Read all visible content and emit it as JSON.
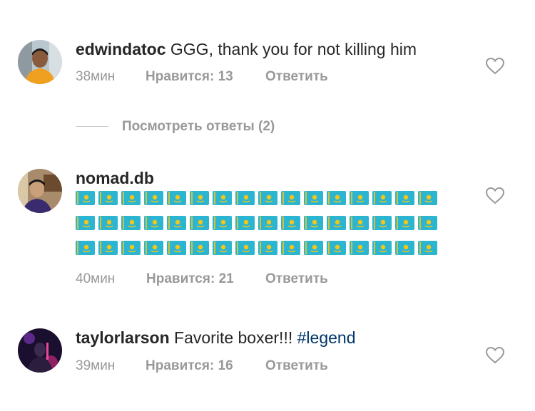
{
  "colors": {
    "username": "#262626",
    "meta": "#999999",
    "hashtag": "#003569",
    "flag": "#2BB5D0",
    "sun": "#F5C518"
  },
  "comments": [
    {
      "username": "edwindatoc",
      "text": " GGG, thank you for not killing him",
      "time": "38мин",
      "likes": "Нравится: 13",
      "reply": "Ответить",
      "view_replies": "Посмотреть ответы (2)"
    },
    {
      "username": "nomad.db",
      "flags_icon": "kazakhstan-flag-emoji",
      "flag_rows": [
        16,
        16,
        16
      ],
      "time": "40мин",
      "likes": "Нравится: 21",
      "reply": "Ответить"
    },
    {
      "username": "taylorlarson",
      "text": " Favorite boxer!!! ",
      "hashtag": "#legend",
      "time": "39мин",
      "likes": "Нравится: 16",
      "reply": "Ответить"
    }
  ]
}
